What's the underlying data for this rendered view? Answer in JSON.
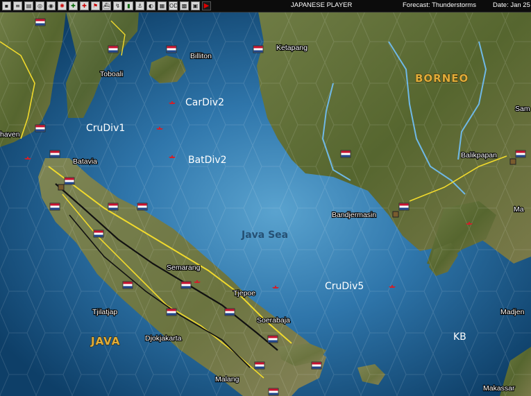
{
  "toolbar": {
    "buttons": [
      "menu-icon",
      "report-icon",
      "save-icon",
      "replay-icon",
      "intel-icon",
      "japan-flag-icon",
      "ground-icon",
      "air-icon",
      "flag-icon",
      "ship-icon",
      "route-icon",
      "base-icon",
      "bomb-icon",
      "globe-icon",
      "map-icon",
      "od-icon",
      "settings-icon",
      "window-icon",
      "end-turn-icon"
    ],
    "player": "JAPANESE PLAYER",
    "forecast": "Forecast: Thunderstorms",
    "date": "Date: Jan 25"
  },
  "map": {
    "regions": {
      "borneo": "BORNEO",
      "java": "JAVA",
      "sea": "Java Sea"
    },
    "places": {
      "toboali": "Toboali",
      "billiton": "Billiton",
      "ketapang": "Ketapang",
      "haven": "haven",
      "batavia": "Batavia",
      "bandjermasin": "Bandjermasin",
      "balikpapan": "Balikpapan",
      "sam": "Sam",
      "semarang": "Semarang",
      "tjepoe": "Tjepoe",
      "soerabaja": "Soerabaja",
      "tjilatjap": "Tjilatjap",
      "djokjakarta": "Djokjakarta",
      "malang": "Malang",
      "madjene": "Madjen",
      "makassar": "Makassar",
      "ma": "Ma"
    },
    "units": {
      "carDiv2": "CarDiv2",
      "cruDiv1": "CruDiv1",
      "batDiv2": "BatDiv2",
      "cruDiv5": "CruDiv5",
      "kb": "KB"
    },
    "colors": {
      "sea_deep": "#124c7a",
      "sea_shallow": "#4a93c2",
      "land": "#5c6b37",
      "road": "#f1da2c",
      "rail": "#111111",
      "region_label": "#e0ad3a"
    }
  }
}
